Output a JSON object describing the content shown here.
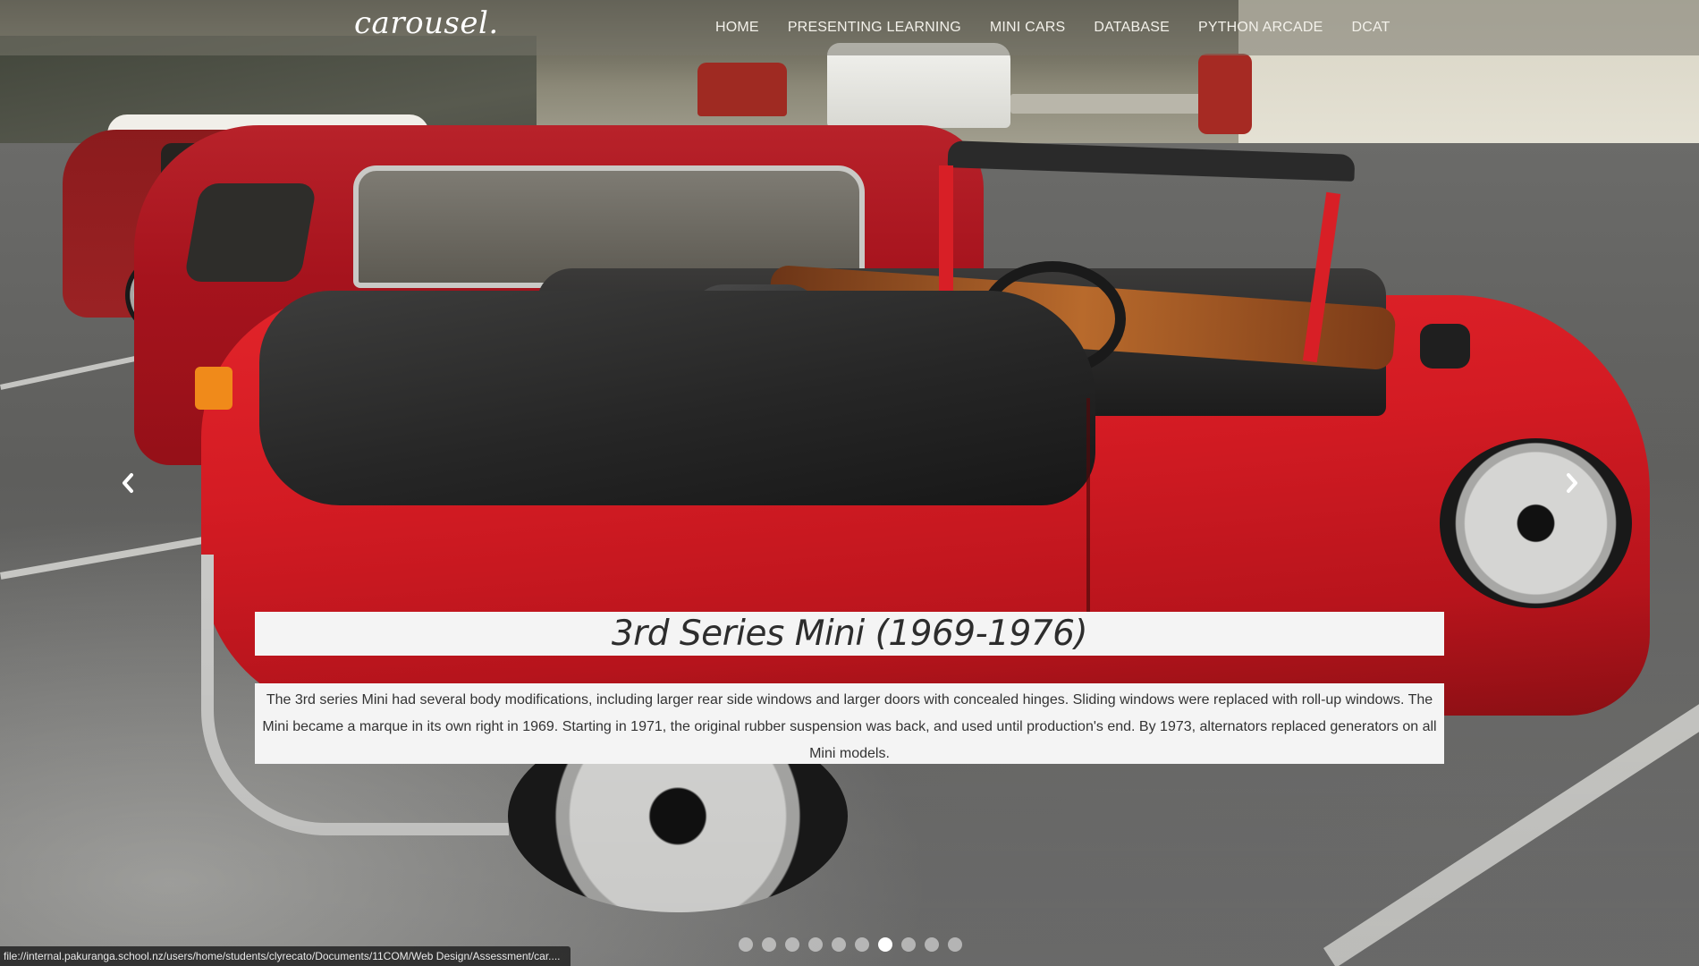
{
  "navbar": {
    "brand": "carousel.",
    "links": [
      {
        "label": "HOME"
      },
      {
        "label": "PRESENTING LEARNING"
      },
      {
        "label": "MINI CARS"
      },
      {
        "label": "DATABASE"
      },
      {
        "label": "PYTHON ARCADE"
      },
      {
        "label": "DCAT"
      }
    ]
  },
  "carousel": {
    "prev_icon": "chevron-left-icon",
    "next_icon": "chevron-right-icon",
    "slide": {
      "title": "3rd Series Mini (1969-1976)",
      "description": "The 3rd series Mini had several body modifications, including larger rear side windows and larger doors with concealed hinges. Sliding windows were replaced with roll-up windows. The Mini became a marque in its own right in 1969. Starting in 1971, the original rubber suspension was back, and used until production's end. By 1973, alternators replaced generators on all Mini models."
    },
    "indicator_count": 10,
    "active_index": 6
  },
  "status_bar": {
    "url": "file://internal.pakuranga.school.nz/users/home/students/clyrecato/Documents/11COM/Web Design/Assessment/car...."
  },
  "colors": {
    "caption_bg": "#f4f4f4",
    "caption_text": "#333333",
    "navbar_text": "#f3f1ea"
  }
}
